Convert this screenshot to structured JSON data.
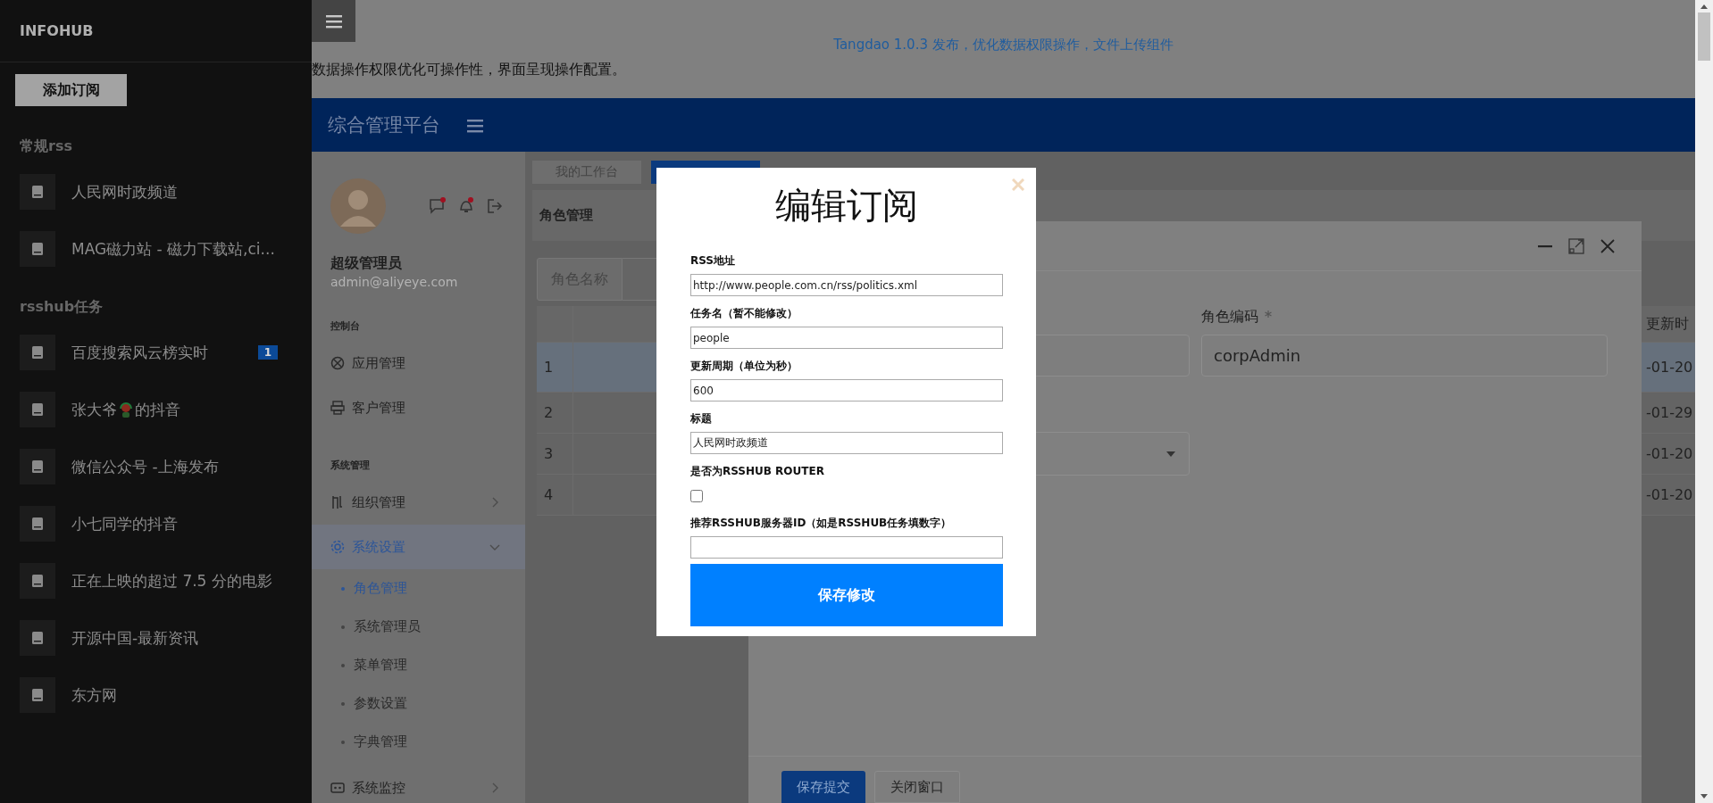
{
  "sidebar": {
    "brand": "INFOHUB",
    "add_button": "添加订阅",
    "groups": [
      {
        "title": "常规rss",
        "items": [
          {
            "label": "人民网时政频道"
          },
          {
            "label": "MAG磁力站 - 磁力下载站,ci..."
          }
        ]
      },
      {
        "title": "rsshub任务",
        "items": [
          {
            "label": "百度搜索风云榜实时",
            "badge": "1"
          },
          {
            "label": "张大爷",
            "label_after_icon": "的抖音"
          },
          {
            "label": "微信公众号 -上海发布"
          },
          {
            "label": "小七同学的抖音"
          },
          {
            "label": "正在上映的超过 7.5 分的电影"
          },
          {
            "label": "开源中国-最新资讯"
          },
          {
            "label": "东方网"
          }
        ]
      }
    ]
  },
  "page": {
    "announcement": "Tangdao 1.0.3 发布，优化数据权限操作，文件上传组件",
    "intro": "数据操作权限优化可操作性，界面呈现操作配置。"
  },
  "app": {
    "title": "综合管理平台",
    "user": {
      "name": "超级管理员",
      "email": "admin@aliyeye.com"
    },
    "nav_sections": [
      {
        "title": "控制台",
        "items": [
          {
            "label": "应用管理",
            "kind": "link",
            "selected": false
          },
          {
            "label": "客户管理",
            "kind": "link",
            "selected": false
          }
        ]
      },
      {
        "title": "系统管理",
        "items": [
          {
            "label": "组织管理",
            "kind": "group",
            "expanded": false,
            "selected": false
          },
          {
            "label": "系统设置",
            "kind": "group",
            "expanded": true,
            "selected": true,
            "children": [
              {
                "label": "角色管理",
                "selected": true
              },
              {
                "label": "系统管理员",
                "selected": false
              },
              {
                "label": "菜单管理",
                "selected": false
              },
              {
                "label": "参数设置",
                "selected": false
              },
              {
                "label": "字典管理",
                "selected": false
              }
            ]
          },
          {
            "label": "系统监控",
            "kind": "group",
            "expanded": false,
            "selected": false
          }
        ]
      }
    ],
    "tabs": [
      {
        "label": "我的工作台",
        "selected": false
      },
      {
        "selected": true
      }
    ],
    "panel_title": "角色管理",
    "search_label": "角色名称",
    "table": {
      "updated_header": "更新时",
      "rows": [
        {
          "number": "1",
          "updated": "-01-20",
          "selected": true
        },
        {
          "number": "2",
          "updated": "-01-29",
          "selected": false
        },
        {
          "number": "3",
          "updated": "-01-20",
          "selected": false
        },
        {
          "number": "4",
          "updated": "-01-20",
          "selected": false
        }
      ]
    },
    "dialog": {
      "code_label": "角色编码",
      "required": true,
      "code_value": "corpAdmin",
      "buttons": [
        {
          "label": "保存提交",
          "kind": "primary"
        },
        {
          "label": "关闭窗口",
          "kind": "default"
        }
      ]
    }
  },
  "modal": {
    "title": "编辑订阅",
    "fields": [
      {
        "label": "RSS地址",
        "kind": "text",
        "value": "http://www.people.com.cn/rss/politics.xml"
      },
      {
        "label": "任务名（暂不能修改）",
        "kind": "text",
        "value": "people"
      },
      {
        "label": "更新周期（单位为秒）",
        "kind": "text",
        "value": "600"
      },
      {
        "label": "标题",
        "kind": "text",
        "value": "人民网时政频道"
      },
      {
        "label": "是否为RSSHUB ROUTER",
        "kind": "checkbox",
        "checked": false
      },
      {
        "label": "推荐RSSHUB服务器ID（如是RSSHUB任务填数字）",
        "kind": "text"
      }
    ],
    "submit": "保存修改"
  }
}
